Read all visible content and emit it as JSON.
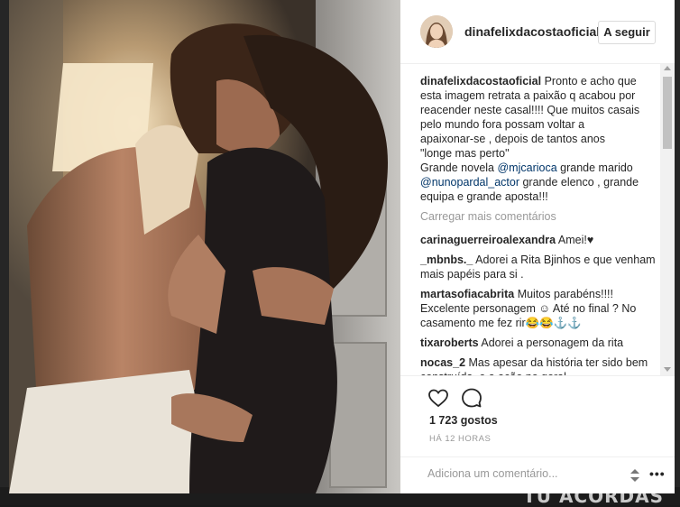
{
  "post": {
    "username": "dinafelixdacostaoficial",
    "follow_label": "A seguir",
    "caption_lines": [
      "Pronto e acho que",
      "esta imagem retrata a paixão q acabou por",
      "reacender neste casal!!!! Que muitos casais",
      "pelo mundo fora possam voltar a",
      "apaixonar-se , depois de tantos anos",
      "\"longe mas perto\""
    ],
    "caption_tail": {
      "p1": "Grande novela ",
      "m1": "@mjcarioca",
      "p2": " grande marido",
      "m2": "@nunopardal_actor",
      "p3": " grande elenco , grande",
      "p4": "equipa e grande aposta!!!"
    },
    "load_more": "Carregar mais comentários",
    "comments": [
      {
        "user": "carinaguerreiroalexandra",
        "text": " Amei!♥"
      },
      {
        "user": "_mbnbs._",
        "text": " Adorei a Rita Bjinhos e que venham mais papéis para si ."
      },
      {
        "user": "martasofiacabrita",
        "text": " Muitos parabéns!!!! Excelente personagem ☺ Até no final ? No casamento me fez rir😂😂⚓⚓"
      },
      {
        "user": "tixaroberts",
        "text": " Adorei a personagem da rita"
      },
      {
        "user": "nocas_2",
        "text": " Mas apesar da história ter sido bem construída, e a ação no geral"
      }
    ],
    "likes": "1 723 gostos",
    "time": "HÁ 12 HORAS",
    "add_comment_placeholder": "Adiciona um comentário..."
  },
  "background": {
    "text": "TU ACORDAS"
  },
  "icons": {
    "like": "heart-icon",
    "comment": "comment-bubble-icon",
    "more": "more-options-icon"
  },
  "colors": {
    "mention": "#003569",
    "muted": "#999999",
    "text": "#262626"
  }
}
